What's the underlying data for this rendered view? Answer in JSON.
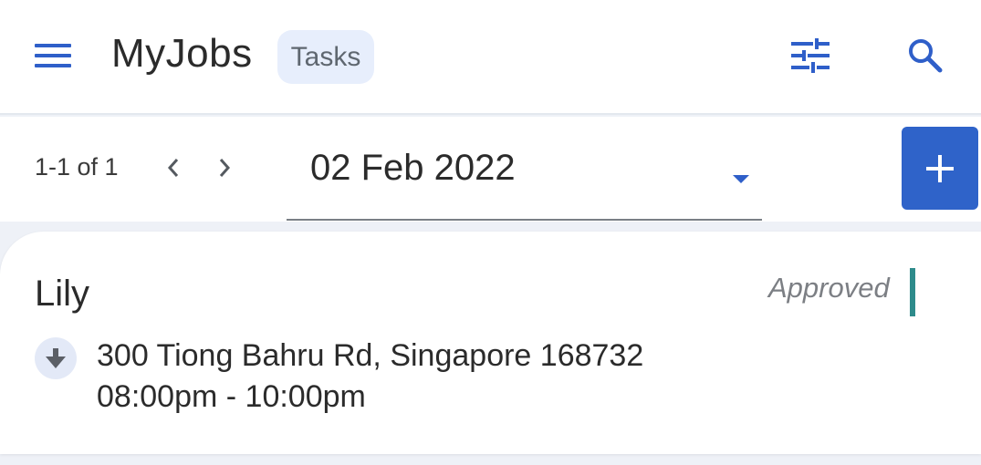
{
  "header": {
    "title": "MyJobs",
    "tab_chip": "Tasks",
    "menu_icon": "hamburger-menu-icon",
    "filter_icon": "tune-sliders-icon",
    "search_icon": "search-icon"
  },
  "toolbar": {
    "range_label": "1-1 of 1",
    "prev_icon": "chevron-left-icon",
    "next_icon": "chevron-right-icon",
    "date_value": "02 Feb 2022",
    "dropdown_icon": "caret-down-icon",
    "add_icon": "plus-icon"
  },
  "jobs": [
    {
      "name": "Lily",
      "status": "Approved",
      "address": "300 Tiong Bahru Rd, Singapore 168732",
      "time": "08:00pm - 10:00pm",
      "direction_icon": "arrow-down-icon"
    }
  ],
  "colors": {
    "accent": "#2f63c9",
    "icon_blue": "#2f5fc9",
    "status_approved": "#2e8b8b",
    "chip_bg": "#e7eefc",
    "page_bg": "#eef1f7"
  }
}
